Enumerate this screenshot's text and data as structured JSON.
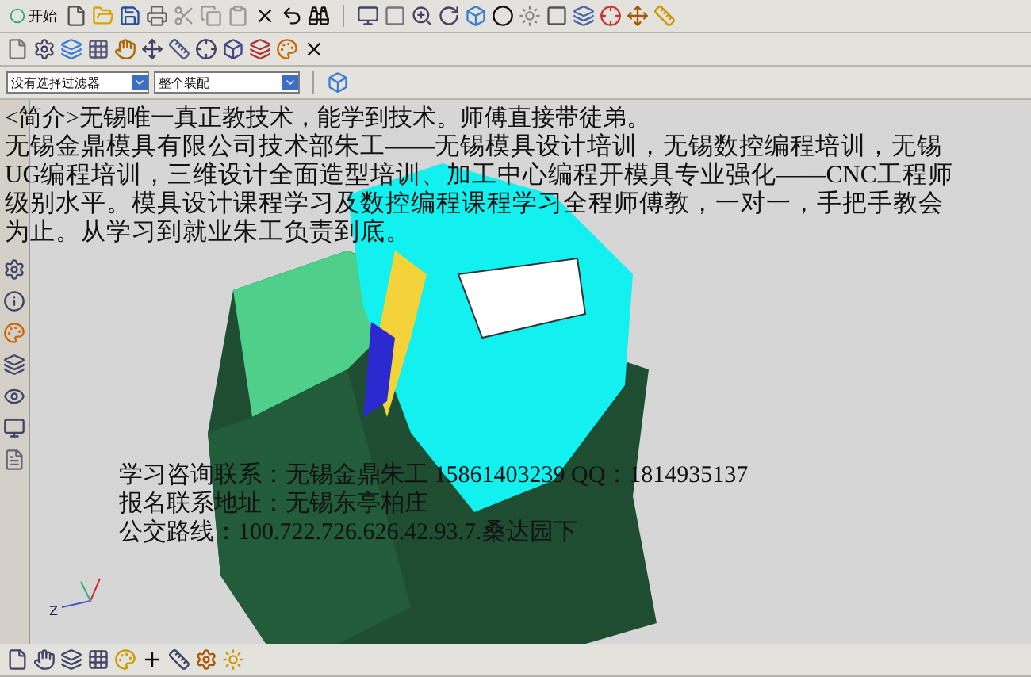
{
  "menu": {
    "start_label": "开始"
  },
  "filters": [
    {
      "value": "没有选择过滤器"
    },
    {
      "value": "整个装配"
    }
  ],
  "overlay": {
    "intro": "<简介>无锡唯一真正教技术，能学到技术。师傅直接带徒弟。",
    "paragraph": "无锡金鼎模具有限公司技术部朱工——无锡模具设计培训，无锡数控编程培训，无锡UG编程培训，三维设计全面造型培训、加工中心编程开模具专业强化——CNC工程师级别水平。模具设计课程学习及数控编程课程学习全程师傅教，一对一，手把手教会为止。从学习到就业朱工负责到底。",
    "contacts": [
      "学习咨询联系：无锡金鼎朱工 15861403239 QQ：1814935137",
      "报名联系地址：无锡东亭柏庄",
      "公交路线：100.722.726.626.42.93.7.桑达园下"
    ]
  },
  "viewport": {
    "axis_label": "Z"
  }
}
